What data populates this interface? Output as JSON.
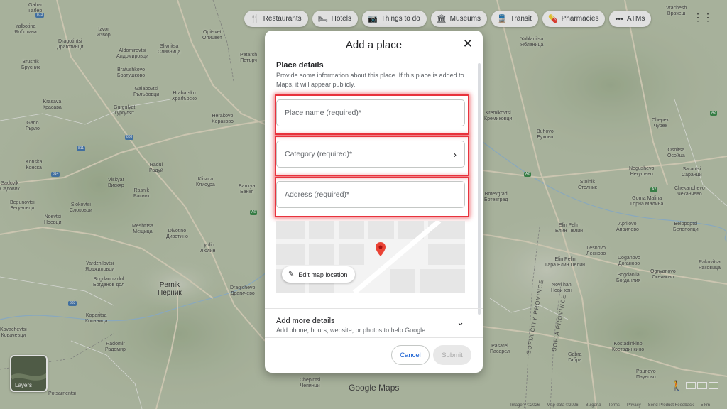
{
  "map": {
    "brand": "Google Maps",
    "layers_label": "Layers",
    "footer": [
      "Imagery ©2026",
      "Map data ©2026",
      "Bulgaria",
      "Terms",
      "Privacy",
      "Send Product Feedback",
      "5 km"
    ],
    "towns": [
      {
        "text": "Gabar"
      },
      {
        "text": "Габер"
      },
      {
        "text": "Yalbotina"
      },
      {
        "text": "Ялботина"
      },
      {
        "text": "Dragotintsi"
      },
      {
        "text": "Драготинци"
      },
      {
        "text": "Izvor"
      },
      {
        "text": "Извор"
      },
      {
        "text": "Aldomirovtsi"
      },
      {
        "text": "Алдомировци"
      },
      {
        "text": "Slivnitsa"
      },
      {
        "text": "Сливница"
      },
      {
        "text": "Opitsvet"
      },
      {
        "text": "Опицвет"
      },
      {
        "text": "Petarch"
      },
      {
        "text": "Петърч"
      },
      {
        "text": "Brusnik"
      },
      {
        "text": "Брусник"
      },
      {
        "text": "Bratushkovo"
      },
      {
        "text": "Братушково"
      },
      {
        "text": "Galabovtsi"
      },
      {
        "text": "Гълъбовци"
      },
      {
        "text": "Hrabarsko"
      },
      {
        "text": "Хрäбърско"
      },
      {
        "text": "Krasava"
      },
      {
        "text": "Красава"
      },
      {
        "text": "Gurgulyat"
      },
      {
        "text": "Гургулят"
      },
      {
        "text": "Herakovo"
      },
      {
        "text": "Хераково"
      },
      {
        "text": "Garlo"
      },
      {
        "text": "Гърло"
      },
      {
        "text": "Konska"
      },
      {
        "text": "Конска"
      },
      {
        "text": "Radui"
      },
      {
        "text": "Радуй"
      },
      {
        "text": "Viskyar"
      },
      {
        "text": "Вискяр"
      },
      {
        "text": "Sadovik"
      },
      {
        "text": "Садовик"
      },
      {
        "text": "Rasnik"
      },
      {
        "text": "Расник"
      },
      {
        "text": "Klisura"
      },
      {
        "text": "Клисура"
      },
      {
        "text": "Bankya"
      },
      {
        "text": "Банкя"
      },
      {
        "text": "Begunovtsi"
      },
      {
        "text": "Бегуновци"
      },
      {
        "text": "Slokovtsi"
      },
      {
        "text": "Слоковци"
      },
      {
        "text": "Noevtsi"
      },
      {
        "text": "Ноевци"
      },
      {
        "text": "Meshtitsa"
      },
      {
        "text": "Мещица"
      },
      {
        "text": "Divotino"
      },
      {
        "text": "Дивотино"
      },
      {
        "text": "Lyulin"
      },
      {
        "text": "Люлин"
      },
      {
        "text": "Yardzhilovtsi"
      },
      {
        "text": "Ярджиловци"
      },
      {
        "text": "Bogdanov dol"
      },
      {
        "text": "Богданов дол"
      },
      {
        "text": "Pernik"
      },
      {
        "text": "Перник"
      },
      {
        "text": "Dragichevo"
      },
      {
        "text": "Драгичево"
      },
      {
        "text": "Koparitsa"
      },
      {
        "text": "Копаница"
      },
      {
        "text": "Kovachevtsi"
      },
      {
        "text": "Ковачевци"
      },
      {
        "text": "Radomir"
      },
      {
        "text": "Радомир"
      },
      {
        "text": "Potsarnentsi"
      },
      {
        "text": "Yablanitsa"
      },
      {
        "text": "Ябланица"
      },
      {
        "text": "Vrachesh"
      },
      {
        "text": "Врачеш"
      },
      {
        "text": "Kremikovtsi"
      },
      {
        "text": "Кремиковци"
      },
      {
        "text": "Chepek"
      },
      {
        "text": "Чурек"
      },
      {
        "text": "Buhovo"
      },
      {
        "text": "Бухово"
      },
      {
        "text": "Osoitsa"
      },
      {
        "text": "Осойца"
      },
      {
        "text": "Negushevo"
      },
      {
        "text": "Негушево"
      },
      {
        "text": "Sarantsi"
      },
      {
        "text": "Саранци"
      },
      {
        "text": "Stolnik"
      },
      {
        "text": "Столник"
      },
      {
        "text": "Chekanchevo"
      },
      {
        "text": "Чеканчево"
      },
      {
        "text": "Gorna Malina"
      },
      {
        "text": "Горна Малина"
      },
      {
        "text": "Botevgrad"
      },
      {
        "text": "Ботевград"
      },
      {
        "text": "Elin Pelin"
      },
      {
        "text": "Елин Пелин"
      },
      {
        "text": "Aprilovo"
      },
      {
        "text": "Априлово"
      },
      {
        "text": "Belopoptsi"
      },
      {
        "text": "Белопопци"
      },
      {
        "text": "Lesnovo"
      },
      {
        "text": "Лесново"
      },
      {
        "text": "Doganovo"
      },
      {
        "text": "Доганово"
      },
      {
        "text": "Elin Pelin"
      },
      {
        "text": "Гара Елин Пелин"
      },
      {
        "text": "Ognyanovo"
      },
      {
        "text": "Огняново"
      },
      {
        "text": "Rakovitsa"
      },
      {
        "text": "Раковица"
      },
      {
        "text": "Bogdanlia"
      },
      {
        "text": "Богданлия"
      },
      {
        "text": "Novi han"
      },
      {
        "text": "Нови хан"
      },
      {
        "text": "Gabra"
      },
      {
        "text": "Габра"
      },
      {
        "text": "Kostadinkino"
      },
      {
        "text": "Костадинкино"
      },
      {
        "text": "Paunovo"
      },
      {
        "text": "Пауново"
      },
      {
        "text": "Pasarel"
      },
      {
        "text": "Пасарел"
      },
      {
        "text": "Chepintsi"
      },
      {
        "text": "Чепинци"
      }
    ],
    "region_labels": [
      "SOFIA CITY PROVINCE",
      "SOFIA PROVINCE"
    ]
  },
  "chips": [
    {
      "icon": "restaurant-icon",
      "glyph": "🍴",
      "label": "Restaurants"
    },
    {
      "icon": "hotel-icon",
      "glyph": "🛏",
      "label": "Hotels"
    },
    {
      "icon": "camera-icon",
      "glyph": "📷",
      "label": "Things to do"
    },
    {
      "icon": "museum-icon",
      "glyph": "🏛",
      "label": "Museums"
    },
    {
      "icon": "transit-icon",
      "glyph": "🚆",
      "label": "Transit"
    },
    {
      "icon": "pharmacy-icon",
      "glyph": "💊",
      "label": "Pharmacies"
    },
    {
      "icon": "atm-icon",
      "glyph": "•••",
      "label": "ATMs"
    }
  ],
  "dialog": {
    "title": "Add a place",
    "section_title": "Place details",
    "section_desc": "Provide some information about this place. If this place is added to Maps, it will appear publicly.",
    "fields": {
      "name_placeholder": "Place name (required)*",
      "category_placeholder": "Category (required)*",
      "address_placeholder": "Address (required)*"
    },
    "edit_location_label": "Edit map location",
    "more_title": "Add more details",
    "more_desc": "Add phone, hours, website, or photos to help Google",
    "cancel_label": "Cancel",
    "submit_label": "Submit"
  },
  "colors": {
    "accent_blue": "#0b57d0",
    "highlight_red": "#e8333d",
    "pin_red": "#ea4335"
  }
}
